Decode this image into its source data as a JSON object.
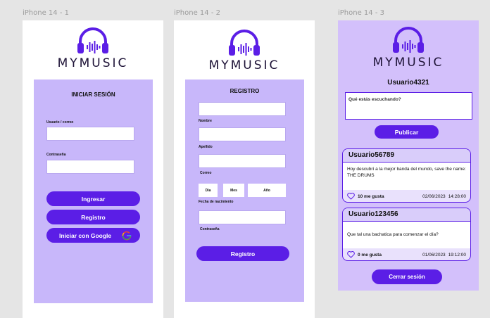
{
  "frames": [
    {
      "label": "iPhone 14 - 1"
    },
    {
      "label": "iPhone 14 - 2"
    },
    {
      "label": "iPhone 14 - 3"
    }
  ],
  "brand": {
    "name": "MYMUSIC",
    "color": "#5b1ee6",
    "icon": "headphones-soundwave-icon"
  },
  "login": {
    "title": "INICIAR SESIÓN",
    "user_label": "Usuario / correo",
    "password_label": "Contraseña",
    "login_button": "Ingresar",
    "register_button": "Registro",
    "google_button": "Iniciar con Google",
    "google_icon": "google-icon"
  },
  "register": {
    "title": "REGISTRO",
    "name_label": "Nombre",
    "surname_label": "Apellido",
    "email_label": "Correo",
    "day": "Día",
    "month": "Mes",
    "year": "Año",
    "birth_label": "Fecha de nacimiento",
    "password_label": "Contraseña",
    "register_button": "Registro"
  },
  "feed": {
    "username": "Usuario4321",
    "compose_placeholder": "Qué estás escuchando?",
    "publish_button": "Publicar",
    "posts": [
      {
        "user": "Usuario56789",
        "text": "Hoy descubrí a la mejor banda del mundo, save the name: THE DRUMS",
        "likes": "10 me gusta",
        "date": "02/06/2023",
        "time": "14:28:00"
      },
      {
        "user": "Usuario123456",
        "text": "Que tal una bachatica para comenzar el día?",
        "likes": "0 me gusta",
        "date": "01/06/2023",
        "time": "19:12:00"
      }
    ],
    "logout_button": "Cerrar sesión"
  },
  "colors": {
    "accent": "#5b1ee6",
    "panel": "#c8b7fa",
    "frame_purple": "#d3c0fb",
    "canvas": "#e5e5e5"
  }
}
